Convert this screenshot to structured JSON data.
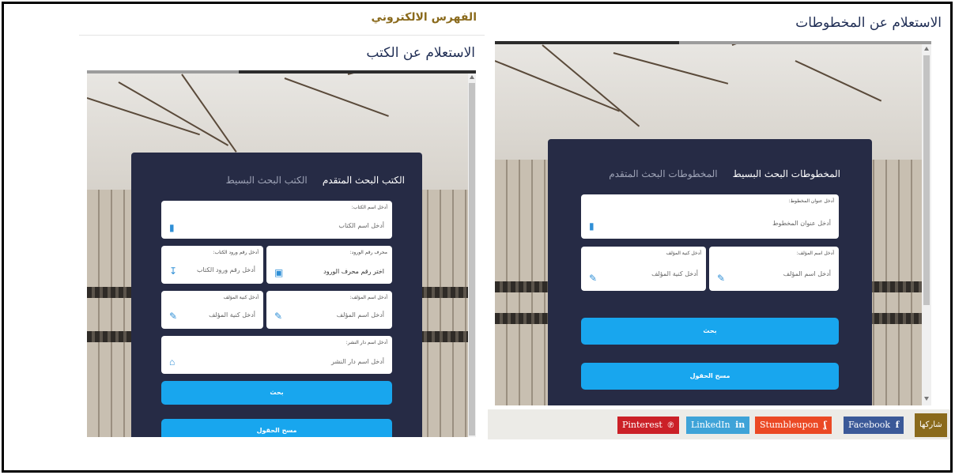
{
  "left_panel": {
    "brand": "الفهرس الالكتروني",
    "title": "الاستعلام عن الكتب",
    "tabs": [
      {
        "label": "الكتب البحث المتقدم",
        "active": true
      },
      {
        "label": "الكتب البحث البسيط",
        "active": false
      }
    ],
    "fields": {
      "book_title": {
        "label": "أدخل اسم الكتاب:",
        "placeholder": "أدخل اسم الكتاب",
        "icon": "book-icon"
      },
      "accession_number": {
        "label": "أدخل رقم ورود الكتاب:",
        "placeholder": "أدخل رقم ورود الكتاب",
        "icon": "sort-numeric-icon"
      },
      "accession_prefix": {
        "label": "محرف رقم الورود:",
        "placeholder": "اختر رقم محرف الورود",
        "icon": "calendar-icon"
      },
      "author_nickname": {
        "label": "أدخل كنية المؤلف",
        "placeholder": "أدخل كنية المؤلف",
        "icon": "pencil-icon"
      },
      "author_name": {
        "label": "أدخل اسم المؤلف:",
        "placeholder": "أدخل اسم المؤلف",
        "icon": "pencil-icon"
      },
      "publisher": {
        "label": "أدخل اسم دار النشر:",
        "placeholder": "أدخل اسم دار النشر",
        "icon": "home-icon"
      }
    },
    "search_button": "بحث",
    "clear_button": "مسح الحقول"
  },
  "right_panel": {
    "title": "الاستعلام عن المخطوطات",
    "tabs": [
      {
        "label": "المخطوطات البحث البسيط",
        "active": true
      },
      {
        "label": "المخطوطات البحث المتقدم",
        "active": false
      }
    ],
    "fields": {
      "manuscript_title": {
        "label": "أدخل عنوان المخطوط:",
        "placeholder": "أدخل عنوان المخطوط",
        "icon": "book-icon"
      },
      "author_nickname": {
        "label": "أدخل كنية المؤلف",
        "placeholder": "أدخل كنية المؤلف",
        "icon": "pencil-icon"
      },
      "author_name": {
        "label": "أدخل اسم المؤلف:",
        "placeholder": "أدخل اسم المؤلف",
        "icon": "pencil-icon"
      }
    },
    "search_button": "بحث",
    "clear_button": "مسح الحقول"
  },
  "share_bar": {
    "label": "شاركها",
    "buttons": [
      {
        "label": "Facebook",
        "glyph": "f",
        "color": "#3b5998"
      },
      {
        "label": "Stumbleupon",
        "glyph": "ʆ",
        "color": "#eb4924"
      },
      {
        "label": "LinkedIn",
        "glyph": "in",
        "color": "#3ea3d8"
      },
      {
        "label": "Pinterest",
        "glyph": "℗",
        "color": "#cb2027"
      }
    ]
  },
  "colors": {
    "card": "#262b45",
    "button": "#18a6ee",
    "brand": "#8a6a1c",
    "share_label": "#8a6a1c"
  }
}
